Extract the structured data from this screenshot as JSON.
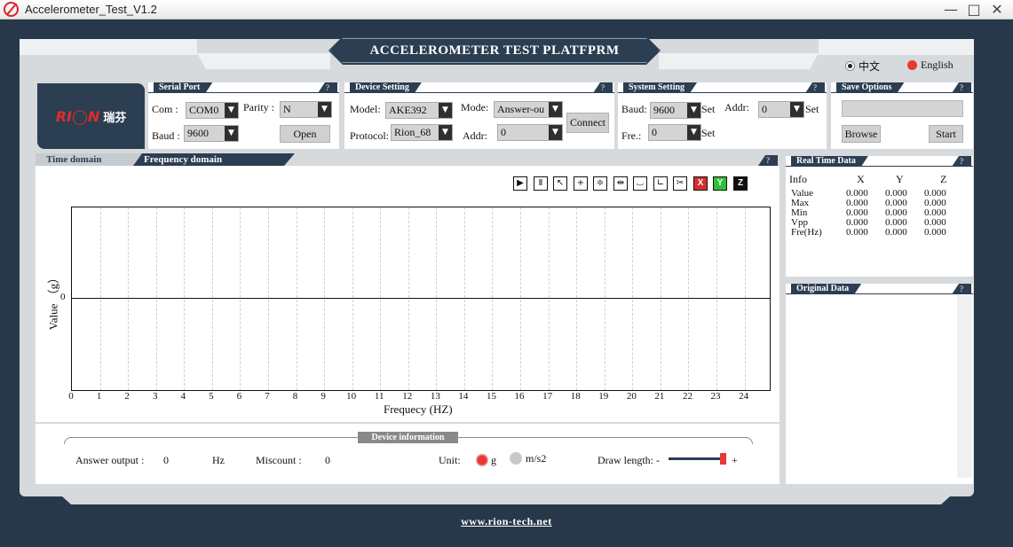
{
  "window": {
    "title": "Accelerometer_Test_V1.2",
    "minimize": "—",
    "maximize": "□",
    "close": "✕"
  },
  "banner": {
    "title": "ACCELEROMETER TEST PLATFPRM"
  },
  "language": {
    "options": [
      {
        "label": "中文",
        "selected": false
      },
      {
        "label": "English",
        "selected": true
      }
    ]
  },
  "logo": {
    "mark": "RI◯N",
    "cn": "瑞芬"
  },
  "serial_port": {
    "title": "Serial Port",
    "help": "?",
    "com_label": "Com :",
    "com_value": "COM0",
    "parity_label": "Parity :",
    "parity_value": "N",
    "baud_label": "Baud :",
    "baud_value": "9600",
    "open_label": "Open"
  },
  "device_setting": {
    "title": "Device Setting",
    "help": "?",
    "model_label": "Model:",
    "model_value": "AKE392",
    "mode_label": "Mode:",
    "mode_value": "Answer-ou",
    "protocol_label": "Protocol:",
    "protocol_value": "Rion_68",
    "addr_label": "Addr:",
    "addr_value": "0",
    "connect_label": "Connect"
  },
  "system_setting": {
    "title": "System Setting",
    "help": "?",
    "baud_label": "Baud:",
    "baud_value": "9600",
    "set1_label": "Set",
    "addr_label": "Addr:",
    "addr_value": "0",
    "set2_label": "Set",
    "fre_label": "Fre.:",
    "fre_value": "0",
    "set3_label": "Set"
  },
  "save_options": {
    "title": "Save Options",
    "help": "?",
    "path_value": "",
    "browse_label": "Browse",
    "start_label": "Start"
  },
  "graph": {
    "tabs": [
      {
        "label": "Time domain",
        "active": false
      },
      {
        "label": "Frequency domain",
        "active": true
      }
    ],
    "help": "?",
    "toolbar": [
      {
        "name": "play-step-icon",
        "glyph": "▶"
      },
      {
        "name": "pause-icon",
        "glyph": "Ⅱ"
      },
      {
        "name": "cursor-icon",
        "glyph": "↖"
      },
      {
        "name": "crosshair-icon",
        "glyph": "+"
      },
      {
        "name": "zoom-vertical-icon",
        "glyph": "≑"
      },
      {
        "name": "zoom-horizontal-icon",
        "glyph": "⇹"
      },
      {
        "name": "fit-icon",
        "glyph": "⌴"
      },
      {
        "name": "zoom-box-icon",
        "glyph": "∟"
      },
      {
        "name": "cut-icon",
        "glyph": "✂"
      },
      {
        "name": "x-channel-icon",
        "glyph": "X",
        "bg": "#d32f2f",
        "color": "#ffffff"
      },
      {
        "name": "y-channel-icon",
        "glyph": "Y",
        "bg": "#2fbf3a",
        "color": "#ffffff"
      },
      {
        "name": "z-channel-icon",
        "glyph": "Z",
        "bg": "#111111",
        "color": "#ffffff"
      }
    ]
  },
  "chart_data": {
    "type": "line",
    "title": "",
    "xlabel": "Frequecy (HZ)",
    "ylabel": "Value （g）",
    "x_ticks": [
      0,
      1,
      2,
      3,
      4,
      5,
      6,
      7,
      8,
      9,
      10,
      11,
      12,
      13,
      14,
      15,
      16,
      17,
      18,
      19,
      20,
      21,
      22,
      23,
      24
    ],
    "y_ticks": [
      0
    ],
    "xlim": [
      0,
      24.9
    ],
    "series": [
      {
        "x": [
          0,
          24.9
        ],
        "y": [
          0,
          0
        ],
        "color": "#111111"
      }
    ],
    "grid": "vertical-dashed"
  },
  "device_info": {
    "title": "Device information",
    "answer_label": "Answer output :",
    "answer_value": "0",
    "answer_unit": "Hz",
    "miscount_label": "Miscount  :",
    "miscount_value": "0",
    "unit_label": "Unit:",
    "unit_g": "g",
    "unit_ms2": "m/s2",
    "unit_selected": "g",
    "draw_label": "Draw length: -",
    "draw_plus": "+",
    "draw_level": 0.97
  },
  "real_time": {
    "title": "Real Time Data",
    "help": "?",
    "header": [
      "Info",
      "X",
      "Y",
      "Z"
    ],
    "rows": [
      [
        "Value",
        "0.000",
        "0.000",
        "0.000"
      ],
      [
        "Max",
        "0.000",
        "0.000",
        "0.000"
      ],
      [
        "Min",
        "0.000",
        "0.000",
        "0.000"
      ],
      [
        "Vpp",
        "0.000",
        "0.000",
        "0.000"
      ],
      [
        "Fre(Hz)",
        "0.000",
        "0.000",
        "0.000"
      ]
    ]
  },
  "original_data": {
    "title": "Original Data",
    "help": "?"
  },
  "footer": {
    "url": "www.rion-tech.net"
  },
  "colors": {
    "navy": "#2c3e52",
    "panel": "#d7dadd",
    "accent_red": "#e53935"
  }
}
